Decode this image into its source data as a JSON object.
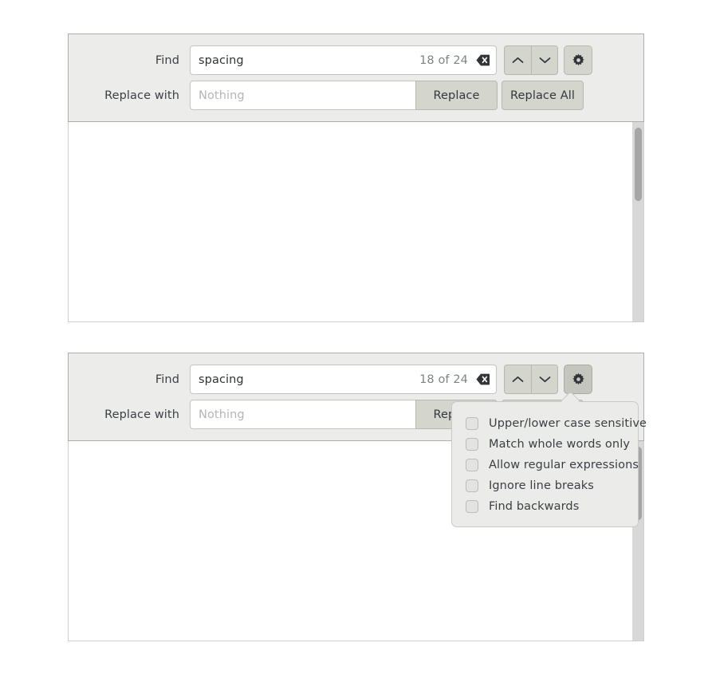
{
  "find_bar": {
    "find_label": "Find",
    "find_value": "spacing",
    "match_count": "18 of 24",
    "clear_icon": "backspace-clear-icon",
    "prev_icon": "chevron-up-icon",
    "next_icon": "chevron-down-icon",
    "settings_icon": "gear-icon",
    "replace_label": "Replace with",
    "replace_placeholder": "Nothing",
    "replace_button": "Replace",
    "replace_all_button": "Replace All"
  },
  "options_popover": {
    "items": [
      {
        "label": "Upper/lower case sensitive",
        "checked": false
      },
      {
        "label": "Match whole words only",
        "checked": false
      },
      {
        "label": "Allow regular expressions",
        "checked": false
      },
      {
        "label": "Ignore line breaks",
        "checked": false
      },
      {
        "label": "Find backwards",
        "checked": false
      }
    ]
  },
  "colors": {
    "toolbar_bg": "#ececeb",
    "toolbar_border": "#aeaeae",
    "button_bg": "#d4d5cd",
    "button_border": "#b7b8b0",
    "button_active_bg": "#c4c6bd",
    "field_bg": "#ffffff",
    "field_border": "#c4c4c2",
    "text": "#3b4045",
    "muted_text": "#7d8387",
    "placeholder_text": "#b4b6b4",
    "popover_bg": "#ebebea",
    "popover_border": "#c9c9c7",
    "scrollbar_track": "#d8d8d8",
    "scrollbar_thumb": "#a6a6a6",
    "page_bg": "#ffffff"
  }
}
